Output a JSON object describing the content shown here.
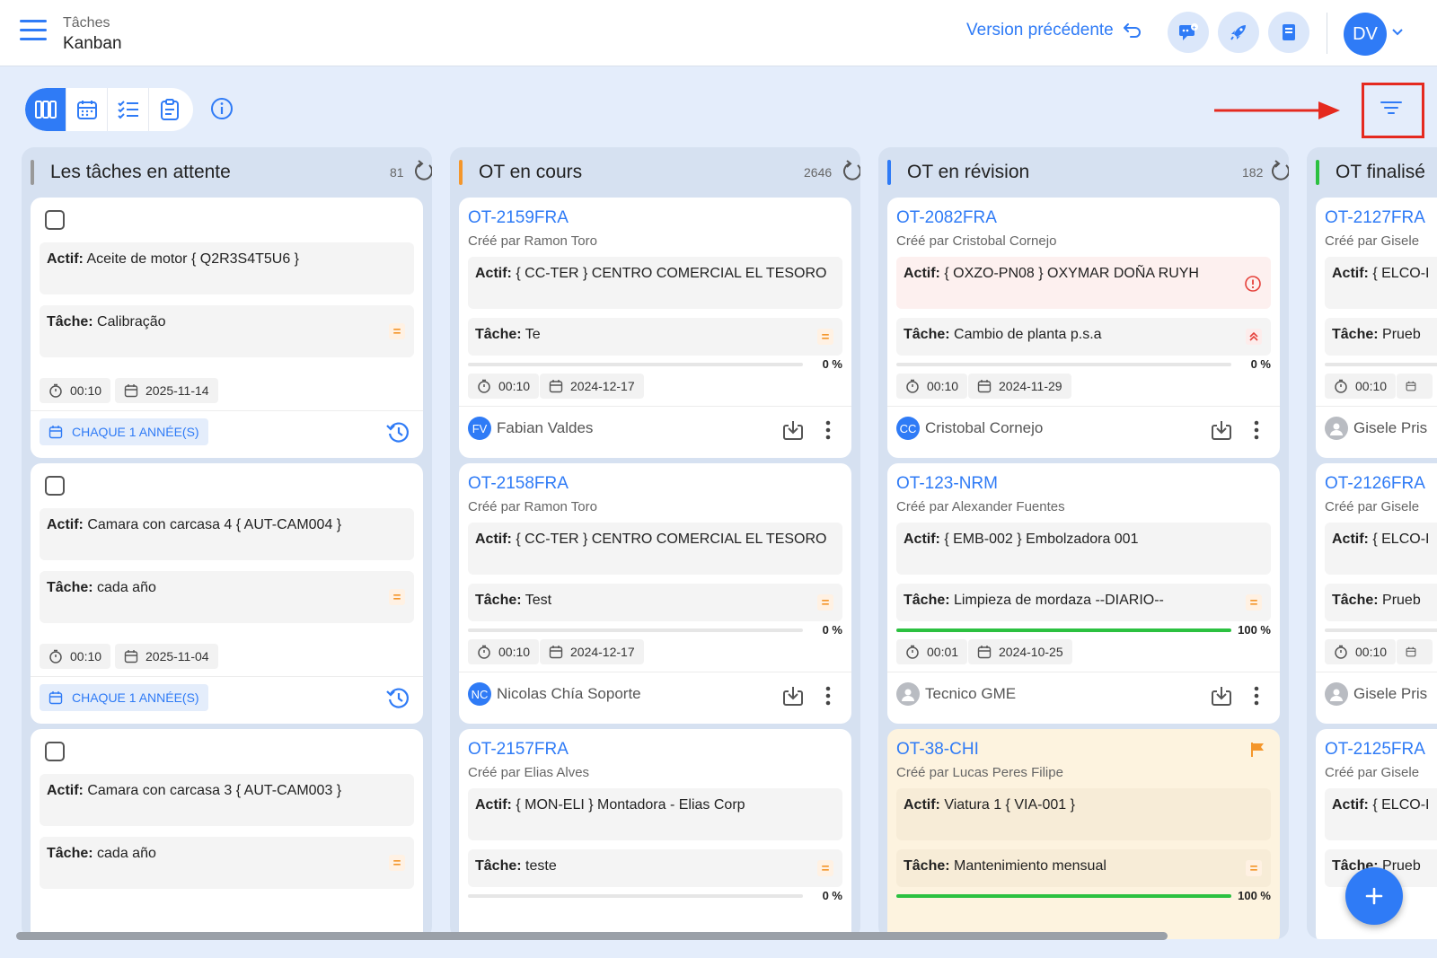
{
  "header": {
    "breadcrumb_small": "Tâches",
    "breadcrumb_main": "Kanban",
    "previous_version_label": "Version précédente",
    "avatar_initials": "DV",
    "accent_color": "#2f7bf6"
  },
  "toolbar": {
    "views": [
      "kanban-columns-icon",
      "calendar-icon",
      "checklist-icon",
      "clipboard-icon"
    ],
    "active_view": "kanban",
    "info_icon": "info-icon",
    "filter_icon": "filter-icon",
    "annotation_color": "#e52a1f"
  },
  "columns": [
    {
      "title": "Les tâches en attente",
      "count": "81",
      "color": "#999999",
      "cards": [
        {
          "asset_label": "Actif:",
          "asset": "Aceite de motor { Q2R3S4T5U6 }",
          "task_label": "Tâche:",
          "task": "Calibração",
          "priority": "=",
          "duration": "00:10",
          "date": "2025-11-14",
          "recurrence": "CHAQUE 1 ANNÉE(S)"
        },
        {
          "asset_label": "Actif:",
          "asset": "Camara con carcasa 4 { AUT-CAM004 }",
          "task_label": "Tâche:",
          "task": "cada año",
          "priority": "=",
          "duration": "00:10",
          "date": "2025-11-04",
          "recurrence": "CHAQUE 1 ANNÉE(S)"
        },
        {
          "asset_label": "Actif:",
          "asset": "Camara con carcasa 3 { AUT-CAM003 }",
          "task_label": "Tâche:",
          "task": "cada año",
          "priority": "="
        }
      ]
    },
    {
      "title": "OT en cours",
      "count": "2646",
      "color": "#f4962b",
      "cards": [
        {
          "id": "OT-2159FRA",
          "creator": "Créé par Ramon Toro",
          "asset_label": "Actif:",
          "asset": "{ CC-TER } CENTRO COMERCIAL EL TESORO",
          "task_label": "Tâche:",
          "task": "Te",
          "priority": "=",
          "progress_percent": 0,
          "progress": "0 %",
          "duration": "00:10",
          "date": "2024-12-17",
          "assignee_initials": "FV",
          "assignee": "Fabian Valdes"
        },
        {
          "id": "OT-2158FRA",
          "creator": "Créé par Ramon Toro",
          "asset_label": "Actif:",
          "asset": "{ CC-TER } CENTRO COMERCIAL EL TESORO",
          "task_label": "Tâche:",
          "task": "Test",
          "priority": "=",
          "progress_percent": 0,
          "progress": "0 %",
          "duration": "00:10",
          "date": "2024-12-17",
          "assignee_initials": "NC",
          "assignee": "Nicolas Chía Soporte"
        },
        {
          "id": "OT-2157FRA",
          "creator": "Créé par Elias Alves",
          "asset_label": "Actif:",
          "asset": "{ MON-ELI } Montadora - Elias Corp",
          "task_label": "Tâche:",
          "task": "teste",
          "priority": "=",
          "progress_percent": 0,
          "progress": "0 %"
        }
      ]
    },
    {
      "title": "OT en révision",
      "count": "182",
      "color": "#2f7bf6",
      "cards": [
        {
          "id": "OT-2082FRA",
          "creator": "Créé par Cristobal Cornejo",
          "asset_label": "Actif:",
          "asset": "{ OXZO-PN08 } OXYMAR DOÑA RUYH",
          "task_label": "Tâche:",
          "task": "Cambio de planta p.s.a",
          "priority": "high",
          "progress_percent": 0,
          "progress": "0 %",
          "duration": "00:10",
          "date": "2024-11-29",
          "assignee_initials": "CC",
          "assignee": "Cristobal Cornejo",
          "warning_icon": "alert-circle-icon"
        },
        {
          "id": "OT-123-NRM",
          "creator": "Créé par Alexander Fuentes",
          "asset_label": "Actif:",
          "asset": "{ EMB-002 } Embolzadora 001",
          "task_label": "Tâche:",
          "task": "Limpieza de mordaza --DIARIO--",
          "priority": "=",
          "progress_percent": 100,
          "progress": "100 %",
          "duration": "00:01",
          "date": "2024-10-25",
          "assignee": "Tecnico GME"
        },
        {
          "id": "OT-38-CHI",
          "creator": "Créé par Lucas Peres Filipe",
          "asset_label": "Actif:",
          "asset": "Viatura 1 { VIA-001 }",
          "task_label": "Tâche:",
          "task": "Mantenimiento mensual",
          "priority": "=",
          "progress_percent": 100,
          "progress": "100 %",
          "flag_icon": "flag-icon"
        }
      ]
    },
    {
      "title": "OT finalisé",
      "color": "#2cc140",
      "cards": [
        {
          "id": "OT-2127FRA",
          "creator": "Créé par Gisele",
          "asset_label": "Actif:",
          "asset": "{ ELCO-I",
          "task_label": "Tâche:",
          "task": "Prueb",
          "duration": "00:10",
          "assignee": "Gisele Pris"
        },
        {
          "id": "OT-2126FRA",
          "creator": "Créé par Gisele",
          "asset_label": "Actif:",
          "asset": "{ ELCO-I",
          "task_label": "Tâche:",
          "task": "Prueb",
          "duration": "00:10",
          "assignee": "Gisele Pris"
        },
        {
          "id": "OT-2125FRA",
          "creator": "Créé par Gisele",
          "asset_label": "Actif:",
          "asset": "{ ELCO-I",
          "task_label": "Tâche:",
          "task": "Prueb"
        }
      ]
    }
  ],
  "fab_icon": "plus-icon"
}
